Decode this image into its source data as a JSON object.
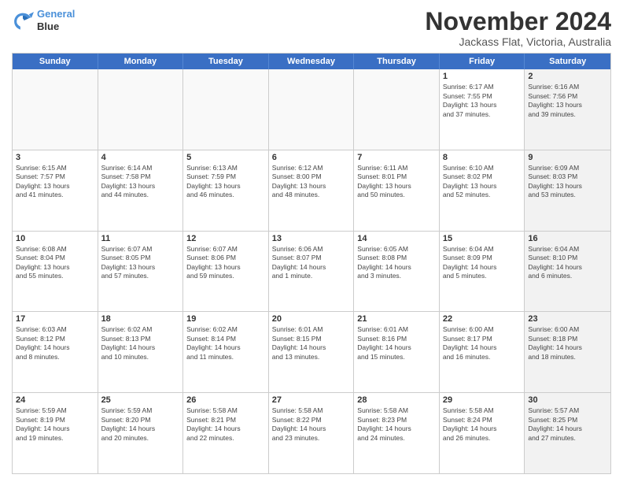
{
  "header": {
    "logo_line1": "General",
    "logo_line2": "Blue",
    "month_title": "November 2024",
    "location": "Jackass Flat, Victoria, Australia"
  },
  "weekdays": [
    "Sunday",
    "Monday",
    "Tuesday",
    "Wednesday",
    "Thursday",
    "Friday",
    "Saturday"
  ],
  "rows": [
    [
      {
        "day": "",
        "detail": "",
        "empty": true
      },
      {
        "day": "",
        "detail": "",
        "empty": true
      },
      {
        "day": "",
        "detail": "",
        "empty": true
      },
      {
        "day": "",
        "detail": "",
        "empty": true
      },
      {
        "day": "",
        "detail": "",
        "empty": true
      },
      {
        "day": "1",
        "detail": "Sunrise: 6:17 AM\nSunset: 7:55 PM\nDaylight: 13 hours\nand 37 minutes.",
        "empty": false,
        "shaded": false
      },
      {
        "day": "2",
        "detail": "Sunrise: 6:16 AM\nSunset: 7:56 PM\nDaylight: 13 hours\nand 39 minutes.",
        "empty": false,
        "shaded": true
      }
    ],
    [
      {
        "day": "3",
        "detail": "Sunrise: 6:15 AM\nSunset: 7:57 PM\nDaylight: 13 hours\nand 41 minutes.",
        "empty": false,
        "shaded": false
      },
      {
        "day": "4",
        "detail": "Sunrise: 6:14 AM\nSunset: 7:58 PM\nDaylight: 13 hours\nand 44 minutes.",
        "empty": false,
        "shaded": false
      },
      {
        "day": "5",
        "detail": "Sunrise: 6:13 AM\nSunset: 7:59 PM\nDaylight: 13 hours\nand 46 minutes.",
        "empty": false,
        "shaded": false
      },
      {
        "day": "6",
        "detail": "Sunrise: 6:12 AM\nSunset: 8:00 PM\nDaylight: 13 hours\nand 48 minutes.",
        "empty": false,
        "shaded": false
      },
      {
        "day": "7",
        "detail": "Sunrise: 6:11 AM\nSunset: 8:01 PM\nDaylight: 13 hours\nand 50 minutes.",
        "empty": false,
        "shaded": false
      },
      {
        "day": "8",
        "detail": "Sunrise: 6:10 AM\nSunset: 8:02 PM\nDaylight: 13 hours\nand 52 minutes.",
        "empty": false,
        "shaded": false
      },
      {
        "day": "9",
        "detail": "Sunrise: 6:09 AM\nSunset: 8:03 PM\nDaylight: 13 hours\nand 53 minutes.",
        "empty": false,
        "shaded": true
      }
    ],
    [
      {
        "day": "10",
        "detail": "Sunrise: 6:08 AM\nSunset: 8:04 PM\nDaylight: 13 hours\nand 55 minutes.",
        "empty": false,
        "shaded": false
      },
      {
        "day": "11",
        "detail": "Sunrise: 6:07 AM\nSunset: 8:05 PM\nDaylight: 13 hours\nand 57 minutes.",
        "empty": false,
        "shaded": false
      },
      {
        "day": "12",
        "detail": "Sunrise: 6:07 AM\nSunset: 8:06 PM\nDaylight: 13 hours\nand 59 minutes.",
        "empty": false,
        "shaded": false
      },
      {
        "day": "13",
        "detail": "Sunrise: 6:06 AM\nSunset: 8:07 PM\nDaylight: 14 hours\nand 1 minute.",
        "empty": false,
        "shaded": false
      },
      {
        "day": "14",
        "detail": "Sunrise: 6:05 AM\nSunset: 8:08 PM\nDaylight: 14 hours\nand 3 minutes.",
        "empty": false,
        "shaded": false
      },
      {
        "day": "15",
        "detail": "Sunrise: 6:04 AM\nSunset: 8:09 PM\nDaylight: 14 hours\nand 5 minutes.",
        "empty": false,
        "shaded": false
      },
      {
        "day": "16",
        "detail": "Sunrise: 6:04 AM\nSunset: 8:10 PM\nDaylight: 14 hours\nand 6 minutes.",
        "empty": false,
        "shaded": true
      }
    ],
    [
      {
        "day": "17",
        "detail": "Sunrise: 6:03 AM\nSunset: 8:12 PM\nDaylight: 14 hours\nand 8 minutes.",
        "empty": false,
        "shaded": false
      },
      {
        "day": "18",
        "detail": "Sunrise: 6:02 AM\nSunset: 8:13 PM\nDaylight: 14 hours\nand 10 minutes.",
        "empty": false,
        "shaded": false
      },
      {
        "day": "19",
        "detail": "Sunrise: 6:02 AM\nSunset: 8:14 PM\nDaylight: 14 hours\nand 11 minutes.",
        "empty": false,
        "shaded": false
      },
      {
        "day": "20",
        "detail": "Sunrise: 6:01 AM\nSunset: 8:15 PM\nDaylight: 14 hours\nand 13 minutes.",
        "empty": false,
        "shaded": false
      },
      {
        "day": "21",
        "detail": "Sunrise: 6:01 AM\nSunset: 8:16 PM\nDaylight: 14 hours\nand 15 minutes.",
        "empty": false,
        "shaded": false
      },
      {
        "day": "22",
        "detail": "Sunrise: 6:00 AM\nSunset: 8:17 PM\nDaylight: 14 hours\nand 16 minutes.",
        "empty": false,
        "shaded": false
      },
      {
        "day": "23",
        "detail": "Sunrise: 6:00 AM\nSunset: 8:18 PM\nDaylight: 14 hours\nand 18 minutes.",
        "empty": false,
        "shaded": true
      }
    ],
    [
      {
        "day": "24",
        "detail": "Sunrise: 5:59 AM\nSunset: 8:19 PM\nDaylight: 14 hours\nand 19 minutes.",
        "empty": false,
        "shaded": false
      },
      {
        "day": "25",
        "detail": "Sunrise: 5:59 AM\nSunset: 8:20 PM\nDaylight: 14 hours\nand 20 minutes.",
        "empty": false,
        "shaded": false
      },
      {
        "day": "26",
        "detail": "Sunrise: 5:58 AM\nSunset: 8:21 PM\nDaylight: 14 hours\nand 22 minutes.",
        "empty": false,
        "shaded": false
      },
      {
        "day": "27",
        "detail": "Sunrise: 5:58 AM\nSunset: 8:22 PM\nDaylight: 14 hours\nand 23 minutes.",
        "empty": false,
        "shaded": false
      },
      {
        "day": "28",
        "detail": "Sunrise: 5:58 AM\nSunset: 8:23 PM\nDaylight: 14 hours\nand 24 minutes.",
        "empty": false,
        "shaded": false
      },
      {
        "day": "29",
        "detail": "Sunrise: 5:58 AM\nSunset: 8:24 PM\nDaylight: 14 hours\nand 26 minutes.",
        "empty": false,
        "shaded": false
      },
      {
        "day": "30",
        "detail": "Sunrise: 5:57 AM\nSunset: 8:25 PM\nDaylight: 14 hours\nand 27 minutes.",
        "empty": false,
        "shaded": true
      }
    ]
  ]
}
